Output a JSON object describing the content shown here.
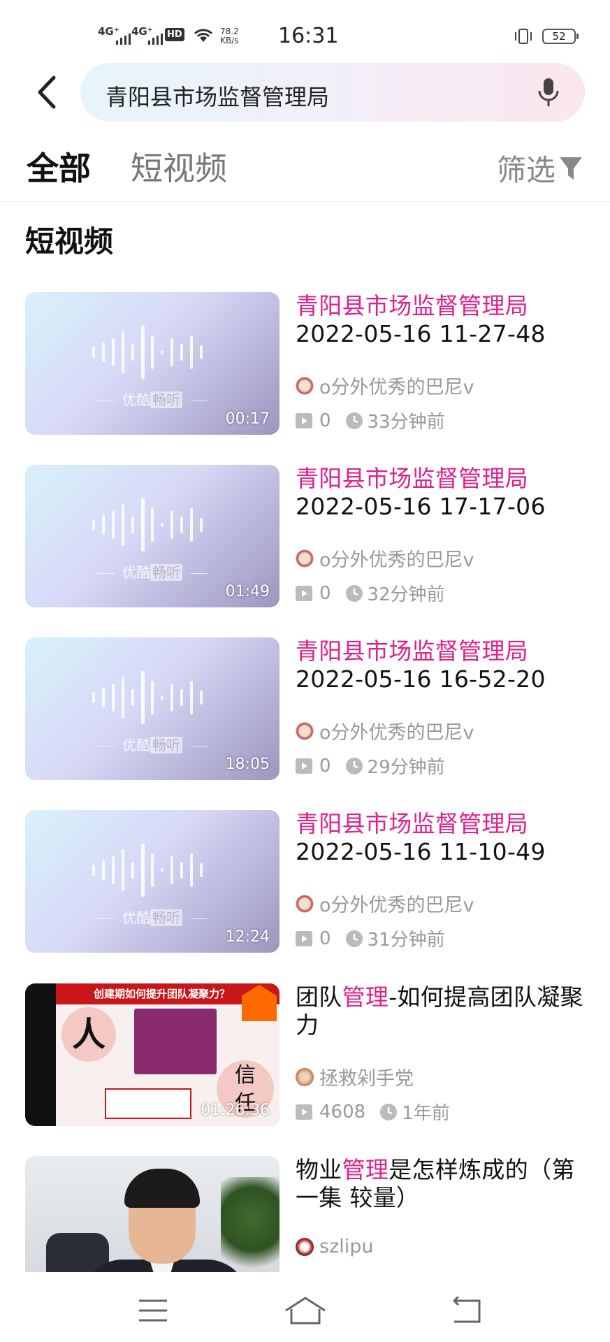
{
  "status_bar": {
    "net1": "4G⁺",
    "net2": "4G⁺",
    "hd": "HD",
    "speed_value": "78.2",
    "speed_unit": "KB/s",
    "time": "16:31",
    "battery": "52"
  },
  "search": {
    "query": "青阳县市场监督管理局",
    "back_icon": "chevron-left-icon",
    "mic_icon": "microphone-icon"
  },
  "tabs": [
    {
      "label": "全部",
      "active": true
    },
    {
      "label": "短视频",
      "active": false
    }
  ],
  "filter": {
    "label": "筛选",
    "icon": "funnel-icon"
  },
  "section_title": "短视频",
  "results": [
    {
      "title_highlight": "青阳县市场监督管理局",
      "title_rest": "2022-05-16 11-27-48",
      "uploader": "o分外优秀的巴尼v",
      "plays": "0",
      "time_ago": "33分钟前",
      "duration": "00:17",
      "thumb_brand": "优酷",
      "thumb_badge": "畅听"
    },
    {
      "title_highlight": "青阳县市场监督管理局",
      "title_rest": "2022-05-16 17-17-06",
      "uploader": "o分外优秀的巴尼v",
      "plays": "0",
      "time_ago": "32分钟前",
      "duration": "01:49",
      "thumb_brand": "优酷",
      "thumb_badge": "畅听"
    },
    {
      "title_highlight": "青阳县市场监督管理局",
      "title_rest": "2022-05-16 16-52-20",
      "uploader": "o分外优秀的巴尼v",
      "plays": "0",
      "time_ago": "29分钟前",
      "duration": "18:05",
      "thumb_brand": "优酷",
      "thumb_badge": "畅听"
    },
    {
      "title_highlight": "青阳县市场监督管理局",
      "title_rest": "2022-05-16 11-10-49",
      "uploader": "o分外优秀的巴尼v",
      "plays": "0",
      "time_ago": "31分钟前",
      "duration": "12:24",
      "thumb_brand": "优酷",
      "thumb_badge": "畅听"
    },
    {
      "title_pre": "团队",
      "title_highlight": "管理",
      "title_post": "-如何提高团队凝聚力",
      "uploader": "拯救剁手党",
      "plays": "4608",
      "time_ago": "1年前",
      "duration": "01:26:36",
      "thumb_text": {
        "heading": "创建期如何提升团队凝聚力？",
        "ren": "人",
        "xin": "信",
        "ren2": "任"
      }
    },
    {
      "title_pre": "物业",
      "title_highlight": "管理",
      "title_post": "是怎样炼成的（第一集 较量）",
      "uploader": "szlipu"
    }
  ],
  "nav": {
    "menu_icon": "menu-icon",
    "home_icon": "home-icon",
    "back_icon": "back-icon"
  },
  "colors": {
    "highlight": "#e0208c",
    "text": "#111111",
    "muted": "#999999"
  }
}
